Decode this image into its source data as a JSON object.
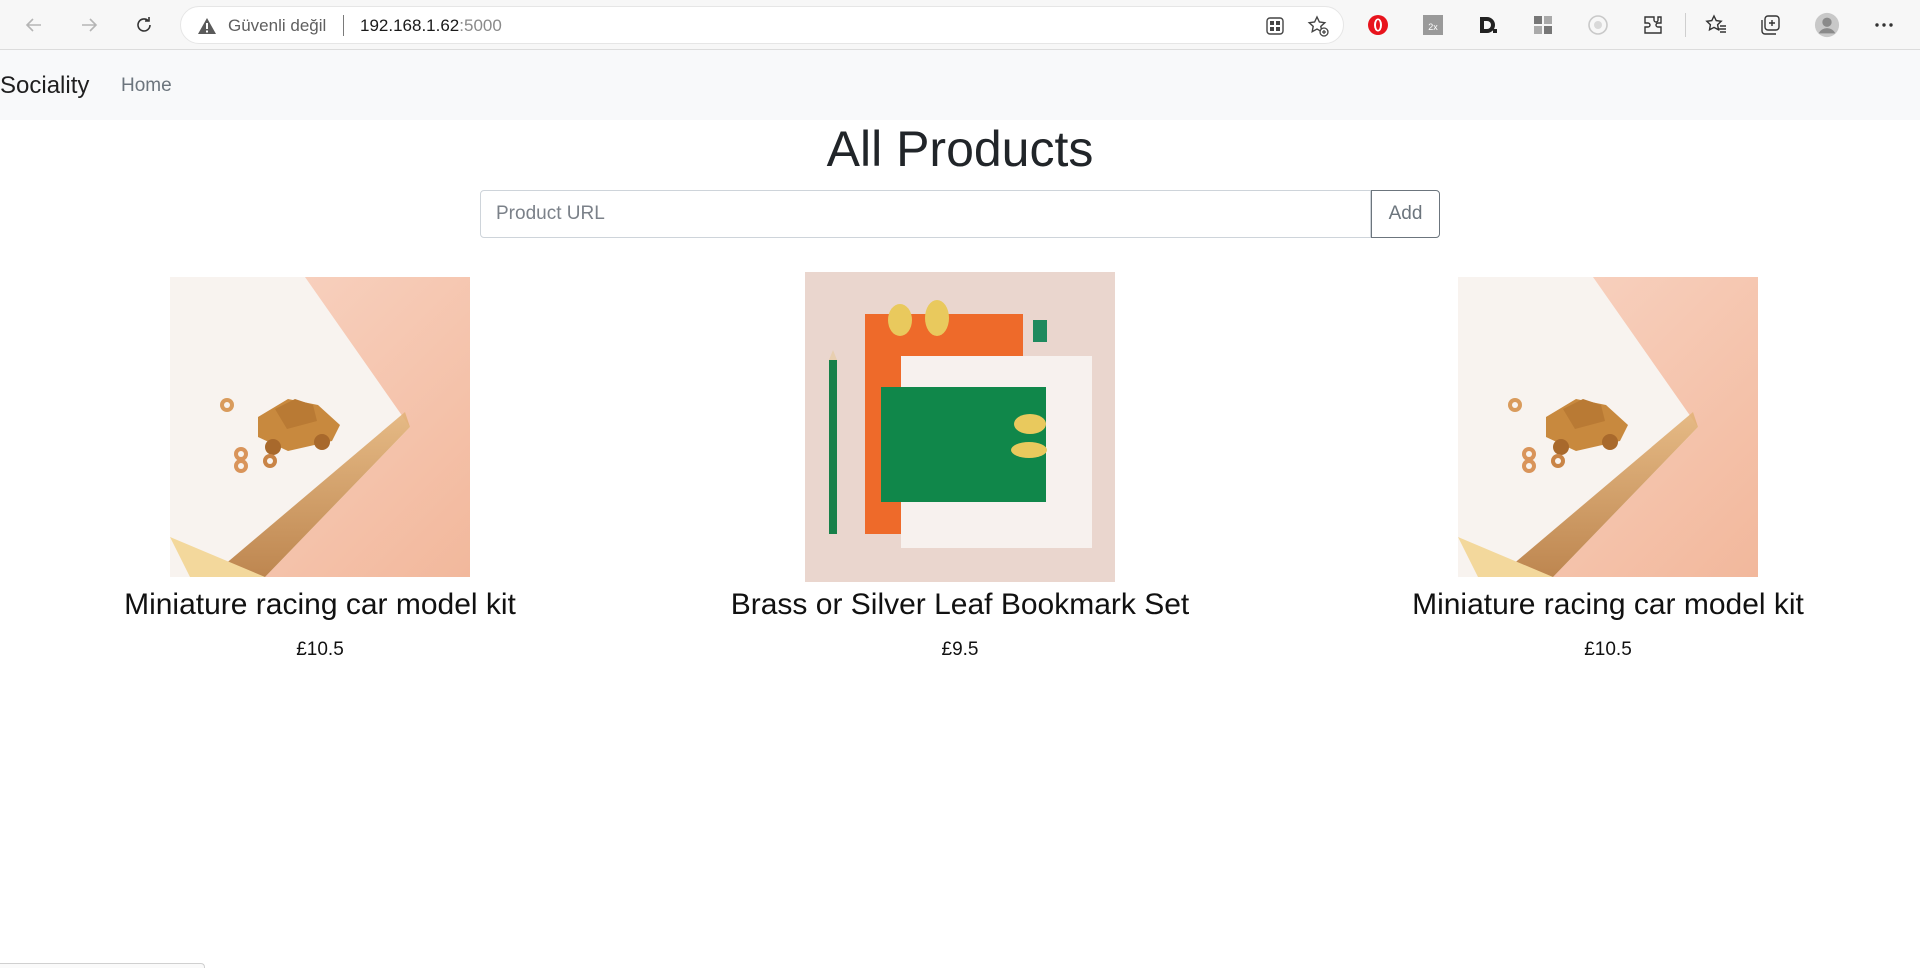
{
  "browser": {
    "security_text": "Güvenli değil",
    "url_host": "192.168.1.62",
    "url_port": ":5000",
    "icons": [
      "back-arrow-icon",
      "forward-arrow-icon",
      "reload-icon",
      "warning-icon",
      "app-available-icon",
      "add-favorite-icon",
      "opera-extension-icon",
      "zoom-extension-icon",
      "d-extension-icon",
      "grid-extension-icon",
      "eye-extension-icon",
      "extensions-icon",
      "favorites-icon",
      "collections-icon",
      "profile-icon",
      "more-icon"
    ]
  },
  "navbar": {
    "brand": "Sociality",
    "home": "Home"
  },
  "main": {
    "title": "All Products",
    "url_placeholder": "Product URL",
    "add_label": "Add"
  },
  "products": [
    {
      "name": "Miniature racing car model kit",
      "price": "£10.5"
    },
    {
      "name": "Brass or Silver Leaf Bookmark Set",
      "price": "£9.5"
    },
    {
      "name": "Miniature racing car model kit",
      "price": "£10.5"
    }
  ],
  "colors": {
    "navbar_bg": "#f8f9fa",
    "text": "#212529",
    "muted": "#6c757d",
    "chrome_bg": "#f7f7f7"
  }
}
